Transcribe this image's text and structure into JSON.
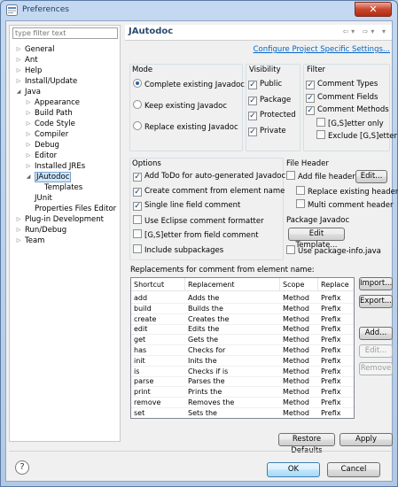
{
  "window": {
    "title": "Preferences",
    "close_label": "✕"
  },
  "filter": {
    "placeholder": "type filter text"
  },
  "tree": {
    "items": [
      {
        "label": "General",
        "expanded": false
      },
      {
        "label": "Ant",
        "expanded": false
      },
      {
        "label": "Help",
        "expanded": false
      },
      {
        "label": "Install/Update",
        "expanded": false
      },
      {
        "label": "Java",
        "expanded": true
      },
      {
        "label": "Appearance",
        "expanded": false
      },
      {
        "label": "Build Path",
        "expanded": false
      },
      {
        "label": "Code Style",
        "expanded": false
      },
      {
        "label": "Compiler",
        "expanded": false
      },
      {
        "label": "Debug",
        "expanded": false
      },
      {
        "label": "Editor",
        "expanded": false
      },
      {
        "label": "Installed JREs",
        "expanded": false
      },
      {
        "label": "JAutodoc",
        "expanded": true,
        "selected": true
      },
      {
        "label": "Templates"
      },
      {
        "label": "JUnit"
      },
      {
        "label": "Properties Files Editor"
      },
      {
        "label": "Plug-in Development",
        "expanded": false
      },
      {
        "label": "Run/Debug",
        "expanded": false
      },
      {
        "label": "Team",
        "expanded": false
      }
    ]
  },
  "page": {
    "title": "JAutodoc",
    "configure_link": "Configure Project Specific Settings...",
    "mode": {
      "label": "Mode",
      "options": [
        "Complete existing Javadoc",
        "Keep existing Javadoc",
        "Replace existing Javadoc"
      ],
      "selected": "Complete existing Javadoc"
    },
    "visibility": {
      "label": "Visibility",
      "items": [
        {
          "label": "Public",
          "checked": true
        },
        {
          "label": "Package",
          "checked": true
        },
        {
          "label": "Protected",
          "checked": true
        },
        {
          "label": "Private",
          "checked": true
        }
      ]
    },
    "filter_group": {
      "label": "Filter",
      "items": [
        {
          "label": "Comment Types",
          "checked": true
        },
        {
          "label": "Comment Fields",
          "checked": true
        },
        {
          "label": "Comment Methods",
          "checked": true
        },
        {
          "label": "[G,S]etter only",
          "checked": false
        },
        {
          "label": "Exclude [G,S]etter",
          "checked": false
        }
      ]
    },
    "options": {
      "label": "Options",
      "items": [
        {
          "label": "Add ToDo for auto-generated Javadoc",
          "checked": true
        },
        {
          "label": "Create comment from element name",
          "checked": true
        },
        {
          "label": "Single line field comment",
          "checked": true
        },
        {
          "label": "Use Eclipse comment formatter",
          "checked": false
        },
        {
          "label": "[G,S]etter from field comment",
          "checked": false
        },
        {
          "label": "Include subpackages",
          "checked": false
        }
      ]
    },
    "file_header": {
      "label": "File Header",
      "add_label": "Add file header",
      "add_checked": false,
      "edit_button": "Edit...",
      "replace_label": "Replace existing header",
      "multi_label": "Multi comment header"
    },
    "package_javadoc": {
      "label": "Package Javadoc",
      "edit_template_button": "Edit Template...",
      "use_package_info": "Use package-info.java",
      "use_checked": false
    },
    "replacements": {
      "label": "Replacements for comment from element name:",
      "columns": [
        "Shortcut",
        "Replacement",
        "Scope",
        "Replace"
      ],
      "rows": [
        [
          "add",
          "Adds the",
          "Method",
          "Prefix"
        ],
        [
          "build",
          "Builds the",
          "Method",
          "Prefix"
        ],
        [
          "create",
          "Creates the",
          "Method",
          "Prefix"
        ],
        [
          "edit",
          "Edits the",
          "Method",
          "Prefix"
        ],
        [
          "get",
          "Gets the",
          "Method",
          "Prefix"
        ],
        [
          "has",
          "Checks for",
          "Method",
          "Prefix"
        ],
        [
          "init",
          "Inits the",
          "Method",
          "Prefix"
        ],
        [
          "is",
          "Checks if is",
          "Method",
          "Prefix"
        ],
        [
          "parse",
          "Parses the",
          "Method",
          "Prefix"
        ],
        [
          "print",
          "Prints the",
          "Method",
          "Prefix"
        ],
        [
          "remove",
          "Removes the",
          "Method",
          "Prefix"
        ],
        [
          "set",
          "Sets the",
          "Method",
          "Prefix"
        ]
      ],
      "buttons": {
        "import": "Import...",
        "export": "Export...",
        "add": "Add...",
        "edit": "Edit...",
        "remove": "Remove"
      }
    },
    "restore_defaults": "Restore Defaults",
    "apply": "Apply"
  },
  "footer": {
    "ok": "OK",
    "cancel": "Cancel",
    "help_glyph": "?"
  },
  "colors": {
    "selection": "#cde8ff",
    "link": "#0066cc",
    "title": "#2c4a6f"
  }
}
